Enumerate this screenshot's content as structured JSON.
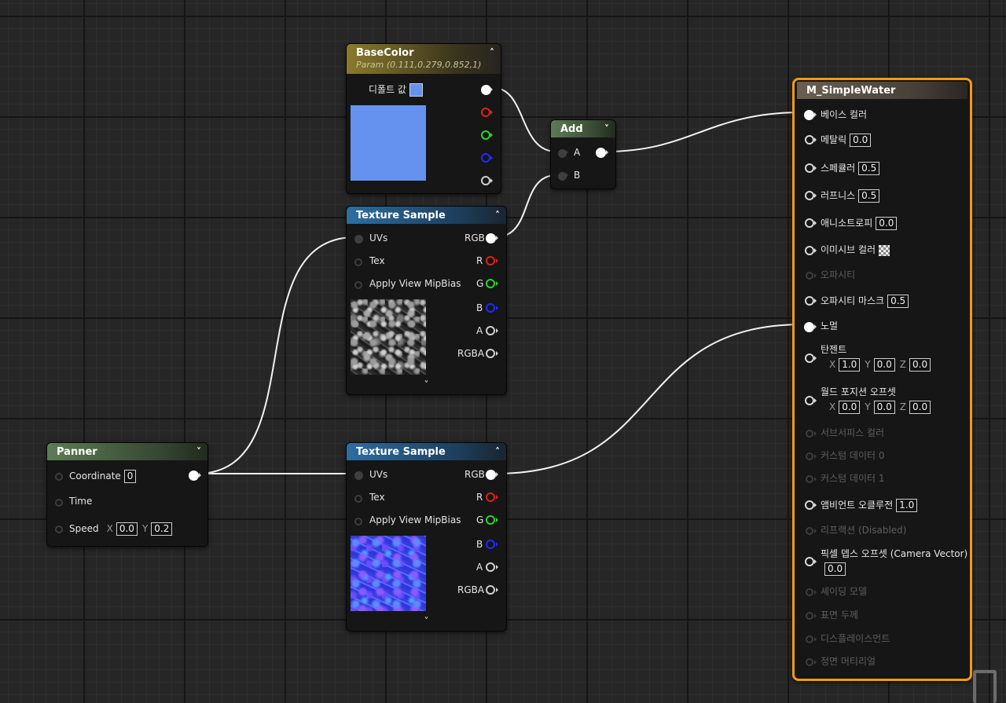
{
  "basecolor_node": {
    "title": "BaseColor",
    "subtitle": "Param (0.111,0.279,0.852,1)",
    "default_label": "디폴트 값",
    "color_hex": "#6492EE"
  },
  "texture1": {
    "title": "Texture Sample",
    "inputs": [
      "UVs",
      "Tex",
      "Apply View MipBias"
    ],
    "outputs": [
      "RGB",
      "R",
      "G",
      "B",
      "A",
      "RGBA"
    ]
  },
  "texture2": {
    "title": "Texture Sample",
    "inputs": [
      "UVs",
      "Tex",
      "Apply View MipBias"
    ],
    "outputs": [
      "RGB",
      "R",
      "G",
      "B",
      "A",
      "RGBA"
    ]
  },
  "add_node": {
    "title": "Add",
    "inputs": [
      "A",
      "B"
    ]
  },
  "panner": {
    "title": "Panner",
    "coordinate_label": "Coordinate",
    "coordinate_value": "0",
    "time_label": "Time",
    "speed_label": "Speed",
    "speed_x_axis": "X",
    "speed_x": "0.0",
    "speed_y_axis": "Y",
    "speed_y": "0.2"
  },
  "material": {
    "title": "M_SimpleWater",
    "pins": {
      "base_color": "베이스 컬러",
      "metallic": "메탈릭",
      "metallic_value": "0.0",
      "specular": "스페큘러",
      "specular_value": "0.5",
      "roughness": "러프니스",
      "roughness_value": "0.5",
      "anisotropy": "애니소트로피",
      "anisotropy_value": "0.0",
      "emissive": "이미시브 컬러",
      "opacity": "오파시티",
      "opacity_mask": "오파시티 마스크",
      "opacity_mask_value": "0.5",
      "normal": "노멀",
      "tangent": "탄젠트",
      "tangent_x_axis": "X",
      "tangent_x": "1.0",
      "tangent_y_axis": "Y",
      "tangent_y": "0.0",
      "tangent_z_axis": "Z",
      "tangent_z": "0.0",
      "wpo": "월드 포지션 오프셋",
      "wpo_x_axis": "X",
      "wpo_x": "0.0",
      "wpo_y_axis": "Y",
      "wpo_y": "0.0",
      "wpo_z_axis": "Z",
      "wpo_z": "0.0",
      "subsurface": "서브서피스 컬러",
      "custom0": "커스텀 데이터 0",
      "custom1": "커스텀 데이터 1",
      "ao": "앰비언트 오클루전",
      "ao_value": "1.0",
      "refraction": "리프랙션 (Disabled)",
      "pdo": "픽셀 뎁스 오프셋 (Camera Vector)",
      "pdo_value": "0.0",
      "shading_model": "셰이딩 모델",
      "surface_thickness": "표면 두께",
      "displacement": "디스플레이스먼트",
      "front_material": "정면 머티리얼"
    }
  },
  "icons": [
    "collapse-chevron-up-icon",
    "collapse-chevron-down-icon",
    "expand-chevron-down-icon"
  ],
  "colors": {
    "selected_outline": "#F29A15",
    "pin_red": "#E0211B",
    "pin_green": "#2BD52B",
    "pin_blue": "#1F2BFF"
  }
}
